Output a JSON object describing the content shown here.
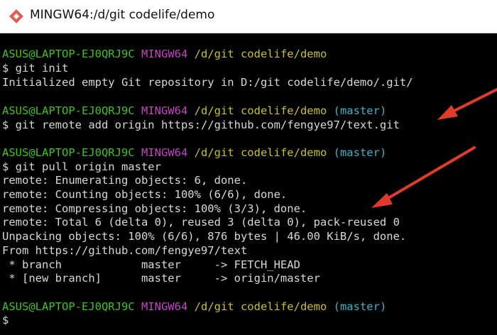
{
  "window": {
    "title": "MINGW64:/d/git codelife/demo",
    "icon": "git-bash-icon"
  },
  "prompt": {
    "user_host": "ASUS@LAPTOP-EJ0QRJ9C",
    "system": "MINGW64",
    "path": "/d/git codelife/demo",
    "branch": "(master)"
  },
  "session": {
    "cmd1": "$ git init",
    "out1": "Initialized empty Git repository in D:/git codelife/demo/.git/",
    "cmd2": "$ git remote add origin https://github.com/fengye97/text.git",
    "cmd3": "$ git pull origin master",
    "pull_output": [
      "remote: Enumerating objects: 6, done.",
      "remote: Counting objects: 100% (6/6), done.",
      "remote: Compressing objects: 100% (3/3), done.",
      "remote: Total 6 (delta 0), reused 3 (delta 0), pack-reused 0",
      "Unpacking objects: 100% (6/6), 876 bytes | 46.00 KiB/s, done.",
      "From https://github.com/fengye97/text",
      " * branch            master     -> FETCH_HEAD",
      " * [new branch]      master     -> origin/master"
    ],
    "final_prompt_char": "$"
  },
  "colors": {
    "user_host": "#3ec41e",
    "system": "#c542c5",
    "path": "#c8c21b",
    "branch": "#3ab5c9",
    "text": "#d8d8d8",
    "background": "#000000",
    "arrow": "#e23a2b"
  }
}
